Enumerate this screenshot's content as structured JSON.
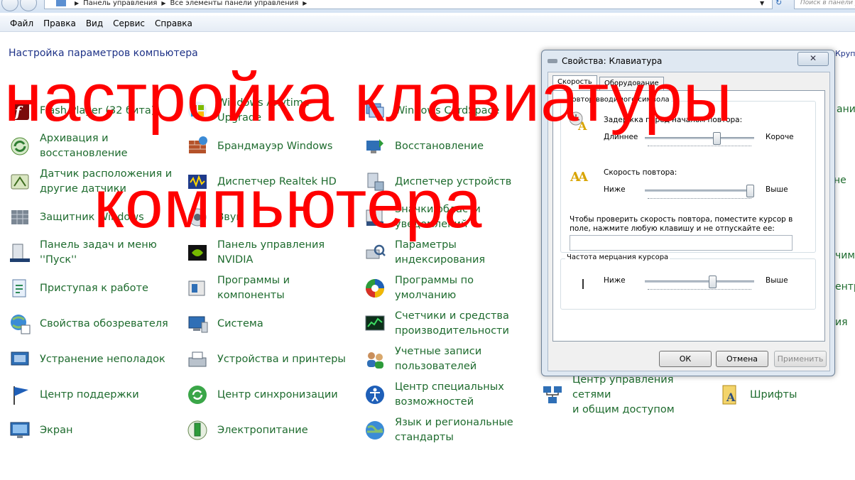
{
  "address_bar": {
    "crumbs": [
      "Панель управления",
      "Все элементы панели управления"
    ],
    "search_placeholder": "Поиск в панели упр..."
  },
  "menu": [
    "Файл",
    "Правка",
    "Вид",
    "Сервис",
    "Справка"
  ],
  "page_title": "Настройка параметров компьютера",
  "right_edge_text": [
    "Крупн",
    "ание",
    "не",
    "чим",
    "ентр",
    "ия"
  ],
  "overlay_lines": [
    "настройка клавиатуры",
    "компьютера"
  ],
  "items": [
    {
      "label": "Flash Player (32 бита)",
      "icon": "flash-icon"
    },
    {
      "label": "Windows Anytime\nUpgrade",
      "icon": "windows-upgrade-icon"
    },
    {
      "label": "Windows CardSpace",
      "icon": "cardspace-icon"
    },
    {
      "label": "Архивация и\nвосстановление",
      "icon": "backup-icon"
    },
    {
      "label": "Брандмауэр Windows",
      "icon": "firewall-icon"
    },
    {
      "label": "Восстановление",
      "icon": "recovery-icon"
    },
    {
      "label": "Датчик расположения и\nдругие датчики",
      "icon": "sensor-icon"
    },
    {
      "label": "Диспетчер Realtek HD",
      "icon": "realtek-icon"
    },
    {
      "label": "Диспетчер устройств",
      "icon": "device-manager-icon"
    },
    {
      "label": "Защитник Windows",
      "icon": "defender-icon"
    },
    {
      "label": "Звук",
      "icon": "sound-icon"
    },
    {
      "label": "Значки области\nуведомлений",
      "icon": "tray-icons-icon"
    },
    {
      "label": "Панель задач и меню\n''Пуск''",
      "icon": "taskbar-icon"
    },
    {
      "label": "Панель управления\nNVIDIA",
      "icon": "nvidia-icon"
    },
    {
      "label": "Параметры\nиндексирования",
      "icon": "indexing-icon"
    },
    {
      "label": "Приступая к работе",
      "icon": "getting-started-icon"
    },
    {
      "label": "Программы и\nкомпоненты",
      "icon": "programs-icon"
    },
    {
      "label": "Программы по\nумолчанию",
      "icon": "default-programs-icon"
    },
    {
      "label": "Свойства обозревателя",
      "icon": "internet-options-icon"
    },
    {
      "label": "Система",
      "icon": "system-icon"
    },
    {
      "label": "Счетчики и средства\nпроизводительности",
      "icon": "performance-icon"
    },
    {
      "label": "Устранение неполадок",
      "icon": "troubleshoot-icon"
    },
    {
      "label": "Устройства и принтеры",
      "icon": "printers-icon"
    },
    {
      "label": "Учетные записи\nпользователей",
      "icon": "users-icon"
    },
    {
      "label": "Центр поддержки",
      "icon": "action-center-icon"
    },
    {
      "label": "Центр синхронизации",
      "icon": "sync-center-icon"
    },
    {
      "label": "Центр специальных\nвозможностей",
      "icon": "accessibility-icon"
    },
    {
      "label": "Центр управления сетями\nи общим доступом",
      "icon": "network-center-icon"
    },
    {
      "label": "Шрифты",
      "icon": "fonts-icon"
    },
    {
      "label": "Экран",
      "icon": "display-icon"
    },
    {
      "label": "Электропитание",
      "icon": "power-icon"
    },
    {
      "label": "Язык и региональные\nстандарты",
      "icon": "region-icon"
    }
  ],
  "dialog": {
    "title": "Свойства: Клавиатура",
    "close_glyph": "✕",
    "tabs": [
      "Скорость",
      "Оборудование"
    ],
    "group_repeat": "Повтор вводимого символа",
    "delay_label": "Задержка перед началом повтора:",
    "delay_left": "Длиннее",
    "delay_right": "Короче",
    "delay_level": 0.67,
    "rate_label": "Скорость повтора:",
    "rate_left": "Ниже",
    "rate_right": "Выше",
    "rate_level": 1.0,
    "test_prompt": "Чтобы проверить скорость повтора, поместите курсор в\nполе, нажмите любую клавишу и не отпускайте ее:",
    "group_blink": "Частота мерцания курсора",
    "blink_left": "Ниже",
    "blink_right": "Выше",
    "blink_level": 0.63,
    "buttons": {
      "ok": "ОК",
      "cancel": "Отмена",
      "apply": "Применить"
    }
  }
}
